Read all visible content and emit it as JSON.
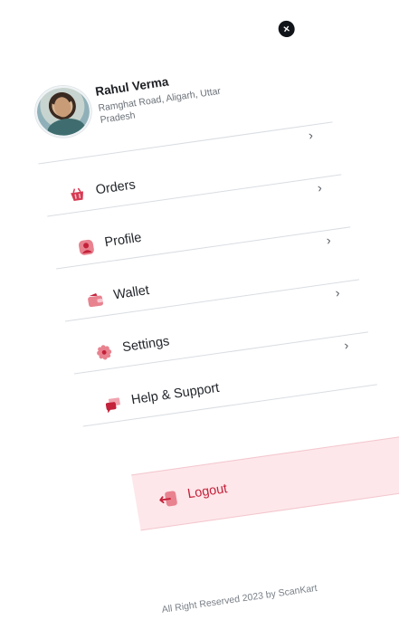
{
  "user": {
    "name": "Rahul Verma",
    "address": "Ramghat Road, Aligarh, Uttar Pradesh"
  },
  "menu": {
    "items": [
      {
        "label": "Orders",
        "icon": "basket-icon"
      },
      {
        "label": "Profile",
        "icon": "user-icon"
      },
      {
        "label": "Wallet",
        "icon": "wallet-icon"
      },
      {
        "label": "Settings",
        "icon": "gear-icon"
      },
      {
        "label": "Help & Support",
        "icon": "chat-bubbles-icon"
      }
    ],
    "chevron": "›"
  },
  "logout": {
    "label": "Logout",
    "icon": "logout-icon"
  },
  "close": {
    "glyph": "×"
  },
  "footer": {
    "text": "All Right Reserved 2023 by ScanKart"
  },
  "colors": {
    "accent": "#c4213a",
    "icon_fill": "#e06a7b",
    "logout_bg": "#fde7ea",
    "text_dark": "#22262b",
    "text_muted": "#6b7178",
    "divider": "#d9dde2"
  }
}
